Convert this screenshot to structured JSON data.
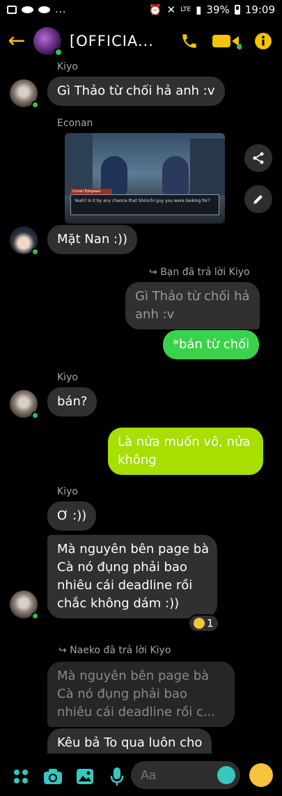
{
  "status": {
    "network": "LTE",
    "battery": "39%",
    "time": "19:09",
    "dots": "..."
  },
  "header": {
    "title": "[OFFICIA..."
  },
  "messages": {
    "m1": {
      "sender": "Kiyo",
      "text": "Gì Thảo từ chối hả anh :v"
    },
    "m2": {
      "sender": "Econan",
      "image": {
        "speaker": "Conan Edogawa",
        "line": "Yeah? Is it by any chance that Shinichi guy you were looking for?"
      }
    },
    "m3": {
      "text": "Mặt Nan :))"
    },
    "m4": {
      "reply_info": "Bạn đã trả lời Kiyo",
      "quoted_1": "Gì Thảo từ chối hả",
      "quoted_2": "anh :v",
      "text": "*bán từ chối"
    },
    "m5": {
      "sender": "Kiyo",
      "text": "bán?"
    },
    "m6": {
      "line1": "Là nửa muốn vô, nửa",
      "line2": "không"
    },
    "m7": {
      "sender": "Kiyo",
      "text": "Ơ :))"
    },
    "m8": {
      "line1": "Mà nguyên bên page bà",
      "line2": "Cà nó đụng phải bao",
      "line3": "nhiêu cái deadline rồi",
      "line4": "chắc không dám :))",
      "reaction_count": "1"
    },
    "m9": {
      "reply_info": "Naeko đã trả lời Kiyo",
      "quoted_1": "Mà nguyên bên page bà",
      "quoted_2": "Cà nó đụng phải bao",
      "quoted_3": "nhiêu cái deadline rồi c...",
      "text": "Kêu bả To qua luôn cho"
    }
  },
  "composer": {
    "placeholder": "Aa"
  },
  "colors": {
    "accent": "#f5c400",
    "online": "#31c24d",
    "green_bubble": "#3bd24b",
    "lime_bubble": "#a6df00"
  }
}
